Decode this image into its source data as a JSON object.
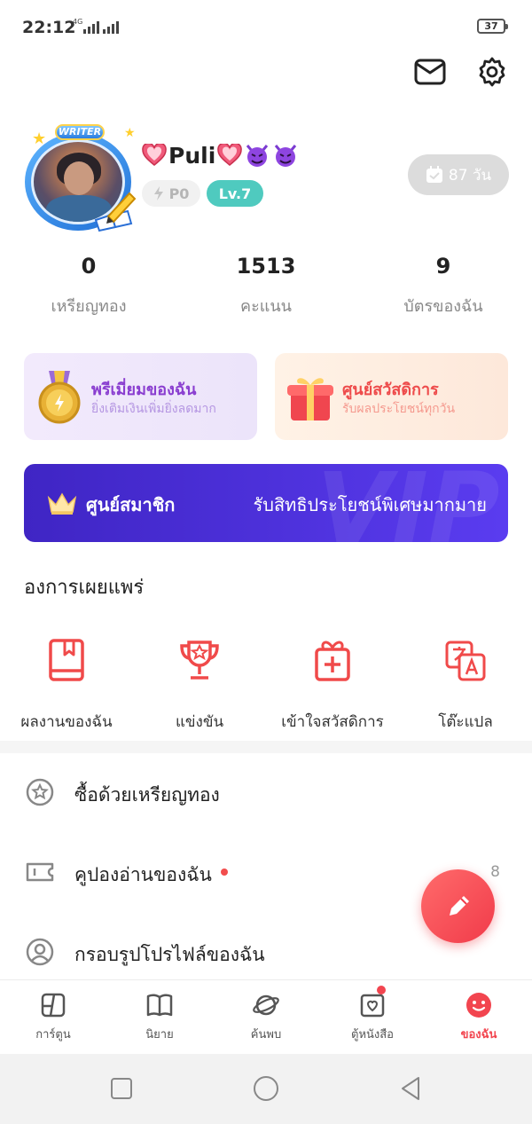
{
  "status_bar": {
    "time": "22:12",
    "network": "4G",
    "battery": "37"
  },
  "profile": {
    "writer_badge": "WRITER",
    "username": "Puli",
    "p_badge": "P0",
    "level_badge": "Lv.7",
    "checkin_days": "87 วัน"
  },
  "stats": [
    {
      "value": "0",
      "label": "เหรียญทอง"
    },
    {
      "value": "1513",
      "label": "คะแนน"
    },
    {
      "value": "9",
      "label": "บัตรของฉัน"
    }
  ],
  "cards": {
    "premium": {
      "title": "พรีเมี่ยมของฉัน",
      "subtitle": "ยิ่งเติมเงินเพิ่มยิ่งลดมาก"
    },
    "welfare": {
      "title": "ศูนย์สวัสดิการ",
      "subtitle": "รับผลประโยชน์ทุกวัน"
    }
  },
  "vip": {
    "title": "ศูนย์สมาชิก",
    "text": "รับสิทธิประโยชน์พิเศษมากมาย",
    "watermark": "VIP"
  },
  "publishing": {
    "title": "องการเผยแพร่",
    "tools": [
      {
        "label": "ผลงานของฉัน",
        "icon": "book-icon"
      },
      {
        "label": "แข่งขัน",
        "icon": "trophy-icon"
      },
      {
        "label": "เข้าใจสวัสดิการ",
        "icon": "gift-icon"
      },
      {
        "label": "โต๊ะแปล",
        "icon": "translate-icon"
      }
    ]
  },
  "menu": [
    {
      "label": "ซื้อด้วยเหรียญทอง",
      "icon": "coin-star-icon"
    },
    {
      "label": "คูปองอ่านของฉัน",
      "icon": "ticket-icon",
      "count": "8"
    },
    {
      "label": "กรอบรูปโปรไฟล์ของฉัน",
      "icon": "avatar-frame-icon"
    }
  ],
  "bottom_nav": [
    {
      "label": "การ์ตูน",
      "icon": "comic-icon"
    },
    {
      "label": "นิยาย",
      "icon": "novel-icon"
    },
    {
      "label": "ค้นพบ",
      "icon": "planet-icon"
    },
    {
      "label": "ตู้หนังสือ",
      "icon": "bookshelf-icon"
    },
    {
      "label": "ของฉัน",
      "icon": "smiley-icon"
    }
  ],
  "colors": {
    "accent": "#f2454f",
    "vip": "#4a2fe0",
    "teal": "#4fcabf"
  }
}
